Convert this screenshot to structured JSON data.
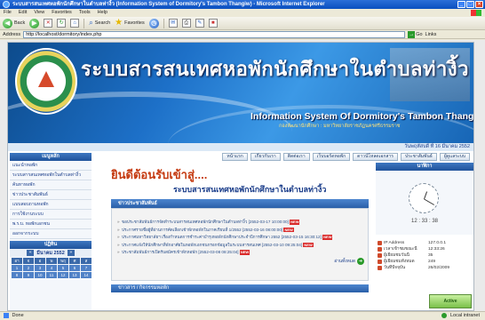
{
  "window": {
    "title": "ระบบสารสนเทศหอพักนักศึกษาในตำบลท่างิ้ว (Information System of Dormitory's Tambon Thangiw) - Microsoft Internet Explorer",
    "controls": [
      "_",
      "□",
      "×"
    ]
  },
  "menu": [
    "File",
    "Edit",
    "View",
    "Favorites",
    "Tools",
    "Help"
  ],
  "toolbar": {
    "back": "Back",
    "search": "Search",
    "favorites": "Favorites"
  },
  "address": {
    "label": "Address",
    "url": "http://localhost/dormitory/index.php",
    "go": "Go",
    "links": "Links"
  },
  "banner": {
    "thai_title": "ระบบสารสนเทศหอพักนักศึกษาในตำบลท่างิ้ว",
    "eng_title": "Information System Of Dormitory's Tambon Thangew",
    "sub_title": "กองพัฒนานักศึกษา : มหาวิทยาลัยราชภัฏนครศรีธรรมราช"
  },
  "date": "วันพฤหัสบดี ที่ 16 มีนาคม 2552",
  "nav": [
    "หน้าแรก",
    "เกี่ยวกับเรา",
    "ติดต่อเรา",
    "เว็บบอร์ดหอพัก",
    "ดาวน์โหลดเอกสาร",
    "ประชาสัมพันธ์",
    "ผู้ดูแลระบบ"
  ],
  "left": {
    "menu_title": "เมนูหลัก",
    "items": [
      "แนะนำหอพัก",
      "ระบบสารสนเทศหอพักในตำบลท่างิ้ว",
      "ค้นหาหอพัก",
      "ข่าวประชาสัมพันธ์",
      "แบบสอบถามหอพัก",
      "การใช้งานระบบ",
      "พ.ร.บ. หอพักเอกชน",
      "ออกจากระบบ"
    ],
    "calendar_title": "ปฏิทิน",
    "calendar_month": "มีนาคม 2552",
    "calendar_days": [
      "อา",
      "จ",
      "อ",
      "พ",
      "พฤ",
      "ศ",
      "ส",
      "1",
      "2",
      "3",
      "4",
      "5",
      "6",
      "7",
      "8",
      "9",
      "10",
      "11",
      "12",
      "13",
      "14"
    ]
  },
  "center": {
    "welcome": "ยินดีต้อนรับเข้าสู่....",
    "welcome_sub": "ระบบสารสนเทศหอพักนักศึกษาในตำบลท่างิ้ว",
    "news_title": "ข่าวประชาสัมพันธ์",
    "news": [
      {
        "text": "ขอประชาสัมพันธ์การจัดทำระบบสารสนเทศหอพักนักศึกษาในตำบลท่างิ้ว [2552-03-17 10:00:00]",
        "badge": "NEW"
      },
      {
        "text": "ประกาศรายชื่อผู้ที่ผ่านการคัดเลือกเข้าพักหอพักในภาคเรียนที่ 1/2552 [2552-03-16 08:00:00]",
        "badge": "NEW"
      },
      {
        "text": "ประกาศมหาวิทยาลัยฯ เรื่องกำหนดการชำระค่าบำรุงหอพักนักศึกษาประจำปีการศึกษา 2552 [2552-03-15 16:30:12]",
        "badge": "NEW"
      },
      {
        "text": "ประกาศแจ้งให้นักศึกษาที่พักอาศัยในหอพักเอกชนกรอกข้อมูลในระบบสารสนเทศ [2552-03-10 09:25:04]",
        "badge": "NEW"
      },
      {
        "text": "ประชาสัมพันธ์การเปิดรับสมัครเข้าพักหอพัก [2552-03-08 08:25:04]",
        "badge": "NEW"
      }
    ],
    "more": "อ่านทั้งหมด",
    "activity_title": "ข่าวสาร / กิจกรรมหอพัก"
  },
  "right": {
    "clock_title": "นาฬิกา",
    "clock_time": "12 : 33 : 38",
    "stats": [
      {
        "label": "IP Address",
        "value": "127.0.0.1"
      },
      {
        "label": "เวลาเข้าชมขณะนี้",
        "value": "12:33:26"
      },
      {
        "label": "ผู้เยี่ยมชมวันนี้",
        "value": "35"
      },
      {
        "label": "ผู้เยี่ยมชมทั้งหมด",
        "value": "249"
      },
      {
        "label": "วันที่ปัจจุบัน",
        "value": "26/02/2009"
      }
    ],
    "ad": "Active"
  },
  "status": {
    "left": "Done",
    "right": "Local intranet"
  }
}
